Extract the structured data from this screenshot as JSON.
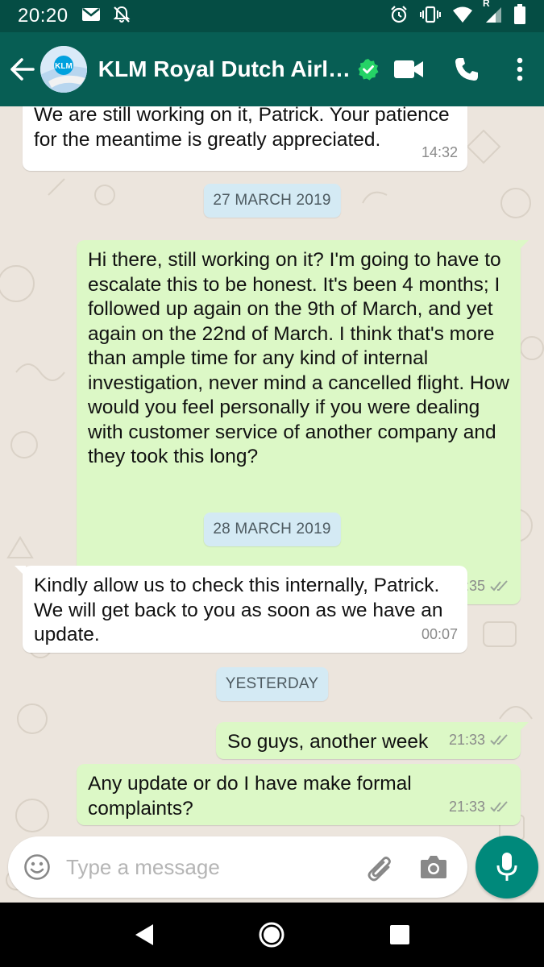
{
  "status_bar": {
    "time": "20:20",
    "icons_left": [
      "mail-icon",
      "notifications-off-icon"
    ],
    "icons_right": [
      "alarm-icon",
      "vibrate-icon",
      "wifi-icon",
      "signal-icon",
      "battery-icon"
    ],
    "roaming_letter": "R"
  },
  "header": {
    "contact_name": "KLM Royal Dutch Airl…",
    "avatar_logo_text": "KLM",
    "verified": true,
    "icons": [
      "back-arrow-icon",
      "video-call-icon",
      "phone-icon",
      "more-vert-icon"
    ]
  },
  "messages": [
    {
      "direction": "in",
      "text": "We are still working on it, Patrick. Your patience for the meantime is greatly appreciated.",
      "time": "14:32"
    },
    {
      "type": "date",
      "text": "27 MARCH 2019"
    },
    {
      "direction": "out",
      "text": "Hi there, still working on it? I'm going to have to escalate this to be honest. It's been 4 months; I followed up again on the 9th of March, and yet again on the 22nd of March. I think that's more than ample time for any kind of internal investigation, never mind a cancelled flight. How would you feel personally if you were dealing with customer service of another company and they took this long?",
      "time": "23:35",
      "status": "read"
    },
    {
      "type": "date",
      "text": "28 MARCH 2019"
    },
    {
      "direction": "in",
      "text": "Kindly allow us to check this internally, Patrick. We will get back to you as soon as we have an update.",
      "time": "00:07"
    },
    {
      "type": "date",
      "text": "YESTERDAY"
    },
    {
      "direction": "out",
      "text": "So guys, another week",
      "time": "21:33",
      "status": "read"
    },
    {
      "direction": "out",
      "text": "Any update or do I have make formal complaints?",
      "time": "21:33",
      "status": "read"
    }
  ],
  "input": {
    "placeholder": "Type a message",
    "value": ""
  },
  "colors": {
    "header": "#075e54",
    "status_bar": "#054d44",
    "outgoing_bubble": "#dcf8c6",
    "incoming_bubble": "#ffffff",
    "chat_background": "#ece5dd",
    "date_chip": "#d4eaf4",
    "mic_button": "#00897b",
    "verified_badge": "#25d366",
    "read_ticks": "#9aa59a"
  }
}
